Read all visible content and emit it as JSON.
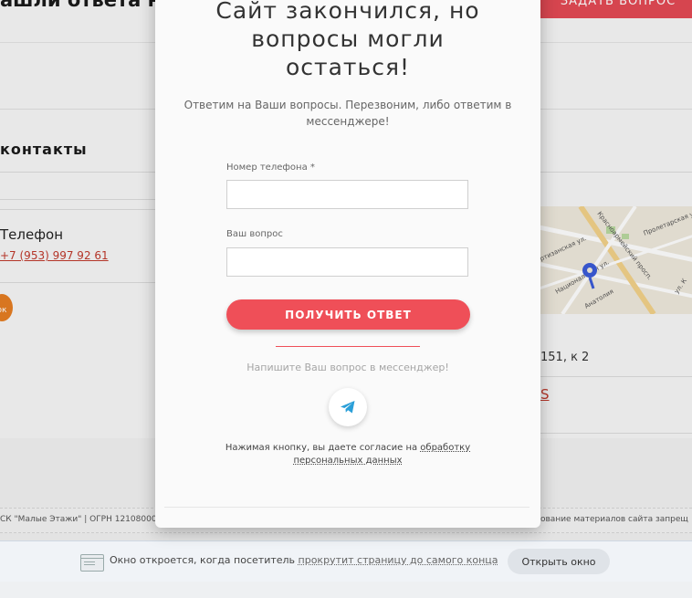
{
  "background_page": {
    "title": "ашли ответа н",
    "ask_button": "ЗАДАТЬ ВОПРОС",
    "contacts_heading": "контакты",
    "phone_label": "Телефон",
    "phone_value": "+7 (953) 997 92 61",
    "ok_icon_glyph": "ок",
    "address_fragment": "151, к 2",
    "link_fragment": "S",
    "footer_left": "СК \"Малые Этажи\" | ОГРН 121080000",
    "footer_right": "ование материалов сайта запрещ",
    "map": {
      "street_labels": [
        "Партизанская ул.",
        "Красноармейский просп.",
        "Пролетарская ул.",
        "Национальная ул.",
        "Анатолия",
        "ул. К"
      ]
    }
  },
  "modal": {
    "title_line1": "Сайт закончился, но",
    "title_line2": "вопросы могли",
    "title_line3": "остаться!",
    "subtitle_line1": "Ответим на Ваши вопросы. Перезвоним, либо ответим в",
    "subtitle_line2": "мессенджере!",
    "phone_label": "Номер телефона *",
    "phone_value": "",
    "question_label": "Ваш вопрос",
    "question_value": "",
    "submit_label": "ПОЛУЧИТЬ ОТВЕТ",
    "messenger_text": "Напишите Ваш вопрос в мессенджер!",
    "consent_text": "Нажимая кнопку, вы даете согласие на ",
    "consent_link_line1": "обработку",
    "consent_link_line2": "персональных данных"
  },
  "bottom_bar": {
    "text": "Окно откроется, когда посетитель ",
    "link": "прокрутит страницу до самого конца",
    "button": "Открыть окно"
  },
  "colors": {
    "accent": "#ef4f58",
    "telegram": "#2a9fd8"
  },
  "icons": {
    "telegram": "telegram-icon",
    "window": "window-icon",
    "ok": "odnoklassniki-icon",
    "map_pin": "map-pin-icon"
  }
}
